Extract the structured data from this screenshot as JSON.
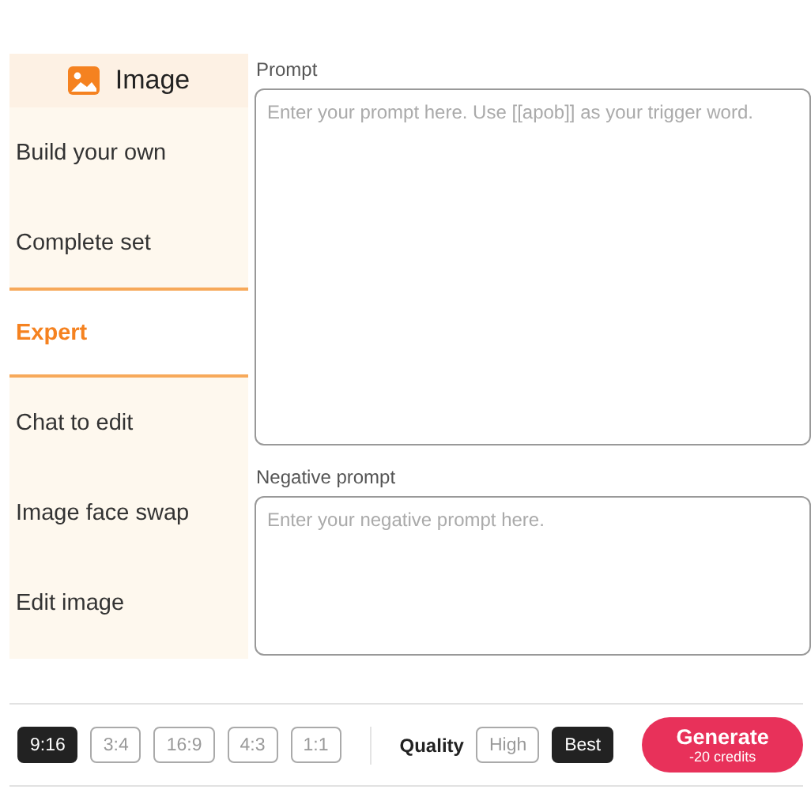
{
  "sidebar": {
    "title": "Image",
    "items": [
      {
        "label": "Build your own",
        "selected": false
      },
      {
        "label": "Complete set",
        "selected": false
      },
      {
        "label": "Expert",
        "selected": true
      },
      {
        "label": "Chat to edit",
        "selected": false
      },
      {
        "label": "Image face swap",
        "selected": false
      },
      {
        "label": "Edit image",
        "selected": false
      }
    ]
  },
  "prompt": {
    "label": "Prompt",
    "placeholder": "Enter your prompt here. Use [[apob]] as your trigger word."
  },
  "negative_prompt": {
    "label": "Negative prompt",
    "placeholder": "Enter your negative prompt here."
  },
  "aspect_ratios": [
    {
      "label": "9:16",
      "selected": true
    },
    {
      "label": "3:4",
      "selected": false
    },
    {
      "label": "16:9",
      "selected": false
    },
    {
      "label": "4:3",
      "selected": false
    },
    {
      "label": "1:1",
      "selected": false
    }
  ],
  "quality": {
    "label": "Quality",
    "options": [
      {
        "label": "High",
        "selected": false
      },
      {
        "label": "Best",
        "selected": true
      }
    ]
  },
  "generate": {
    "label": "Generate",
    "cost": "-20 credits"
  }
}
